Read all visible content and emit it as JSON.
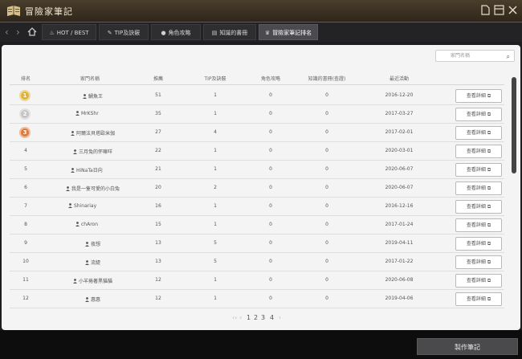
{
  "app": {
    "title": "冒險家筆記"
  },
  "tabs": [
    {
      "label": "HOT / BEST",
      "icon": "flame-icon"
    },
    {
      "label": "TIP及訣竅",
      "icon": "pencil-icon"
    },
    {
      "label": "角色攻略",
      "icon": "person-icon"
    },
    {
      "label": "知識的書冊",
      "icon": "book-icon"
    },
    {
      "label": "冒險家筆記排名",
      "icon": "trophy-icon"
    }
  ],
  "search": {
    "placeholder": "家門名稱"
  },
  "table": {
    "headers": [
      "排名",
      "家門名稱",
      "推薦",
      "TIP及訣竅",
      "角色攻略",
      "知識的書冊(查證)",
      "最近活動"
    ],
    "button_label": "查看詳細",
    "rows": [
      {
        "rank": "1",
        "name": "鯛魚王",
        "rec": "51",
        "tip": "1",
        "guide": "0",
        "know": "0",
        "date": "2016-12-20",
        "medal": "gold"
      },
      {
        "rank": "2",
        "name": "MrKShr",
        "rec": "35",
        "tip": "1",
        "guide": "0",
        "know": "0",
        "date": "2017-03-27",
        "medal": "silver"
      },
      {
        "rank": "3",
        "name": "阿爾法貝塔歐米伽",
        "rec": "27",
        "tip": "4",
        "guide": "0",
        "know": "0",
        "date": "2017-02-01",
        "medal": "bronze"
      },
      {
        "rank": "4",
        "name": "三月兔的怀嘛咩",
        "rec": "22",
        "tip": "1",
        "guide": "0",
        "know": "0",
        "date": "2020-03-01",
        "medal": ""
      },
      {
        "rank": "5",
        "name": "HiNaTa日向",
        "rec": "21",
        "tip": "1",
        "guide": "0",
        "know": "0",
        "date": "2020-06-07",
        "medal": ""
      },
      {
        "rank": "6",
        "name": "我是一隻可愛的小白兔",
        "rec": "20",
        "tip": "2",
        "guide": "0",
        "know": "0",
        "date": "2020-06-07",
        "medal": ""
      },
      {
        "rank": "7",
        "name": "Shinariay",
        "rec": "16",
        "tip": "1",
        "guide": "0",
        "know": "0",
        "date": "2016-12-16",
        "medal": ""
      },
      {
        "rank": "8",
        "name": "chAron",
        "rec": "15",
        "tip": "1",
        "guide": "0",
        "know": "0",
        "date": "2017-01-24",
        "medal": ""
      },
      {
        "rank": "9",
        "name": "夜想",
        "rec": "13",
        "tip": "5",
        "guide": "0",
        "know": "0",
        "date": "2019-04-11",
        "medal": ""
      },
      {
        "rank": "10",
        "name": "流緹",
        "rec": "13",
        "tip": "5",
        "guide": "0",
        "know": "0",
        "date": "2017-01-22",
        "medal": ""
      },
      {
        "rank": "11",
        "name": "小羊捲著黑貓貓",
        "rec": "12",
        "tip": "1",
        "guide": "0",
        "know": "0",
        "date": "2020-06-08",
        "medal": ""
      },
      {
        "rank": "12",
        "name": "惠惠",
        "rec": "12",
        "tip": "1",
        "guide": "0",
        "know": "0",
        "date": "2019-04-06",
        "medal": ""
      }
    ]
  },
  "pagination": {
    "prev": "‹‹ ‹",
    "pages": [
      "1",
      "2",
      "3",
      "4"
    ],
    "next": "›"
  },
  "footer": {
    "make_button": "製作筆記"
  },
  "colors": {
    "gold": "#e0b23a",
    "silver": "#c4c4c4",
    "bronze": "#e0793a"
  }
}
